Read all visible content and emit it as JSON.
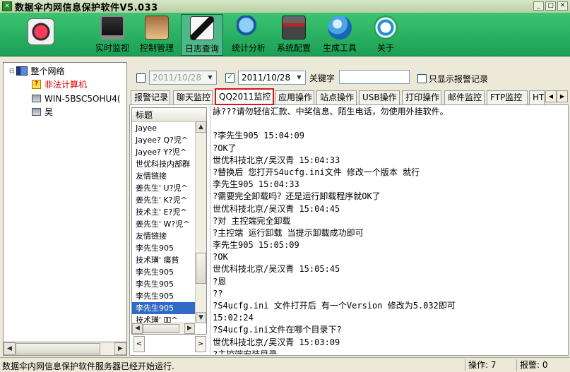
{
  "window": {
    "title": "数据伞内网信息保护软件V5.033"
  },
  "toolbar": {
    "items": [
      {
        "label": "",
        "icon": "record-icon"
      },
      {
        "label": "实时监视",
        "icon": "monitor-icon"
      },
      {
        "label": "控制管理",
        "icon": "people-icon"
      },
      {
        "label": "日志查询",
        "icon": "log-icon",
        "active": true
      },
      {
        "label": "统计分析",
        "icon": "magnifier-icon"
      },
      {
        "label": "系统配置",
        "icon": "tools-icon"
      },
      {
        "label": "生成工具",
        "icon": "globe-icon"
      },
      {
        "label": "关于",
        "icon": "at-icon"
      }
    ]
  },
  "tree": {
    "root": "整个网络",
    "items": [
      "非法计算机",
      "WIN-5BSC5OHU4(",
      "吴"
    ]
  },
  "filter": {
    "date_from": "2011/10/28",
    "date_to": "2011/10/28",
    "keyword_label": "关键字",
    "keyword_value": "",
    "alarm_only_label": "只显示报警记录"
  },
  "tabs": [
    "报警记录",
    "聊天监控",
    "QQ2011监控",
    "应用操作",
    "站点操作",
    "USB操作",
    "打印操作",
    "邮件监控",
    "FTP监控",
    "HT"
  ],
  "active_tab": "QQ2011监控",
  "contact_list": {
    "header": "标题",
    "rows": [
      "Jayee",
      "Jayee?  Q?児^",
      "Jayee?  Y?児^",
      "世优科技内部群",
      "友情链接",
      "姜先生' U?児^",
      "姜先生' K?児^",
      "技术主' E?児^",
      "姜先生' W?児^",
      "友情链接",
      "李先生905",
      "技术璜'  瘍貧",
      "李先生905",
      "李先生905",
      "李先生905",
      "李先生905",
      "技术璜'  吅^"
    ],
    "selected_index": 15
  },
  "chat": {
    "lines": [
      "詠???请勿轻信汇款、中奖信息、陌生电话，勿使用外挂软件。",
      "",
      "?李先生905  15:04:09",
      "?OK了",
      "世优科技北京/吴汉青  15:04:33",
      "?替换后 您打开S4ucfg.ini文件 修改一个版本 就行",
      "李先生905  15:04:33",
      "?需要完全卸载吗？还是运行卸载程序就OK了",
      "世优科技北京/吴汉青  15:04:45",
      "?对 主控端完全卸载",
      "?主控端 运行卸载 当提示卸载成功即可",
      "李先生905  15:05:09",
      "?OK",
      "世优科技北京/吴汉青  15:05:45",
      "?恩",
      "??",
      "?S4ucfg.ini 文件打开后 有一个Version 修改为5.032即可",
      "15:02:24",
      "?S4ucfg.ini文件在哪个目录下?",
      "世优科技北京/吴汉青  15:03:09",
      "?主控端安装目录"
    ]
  },
  "status": {
    "message": "数据伞内网信息保护软件服务器已经开始运行.",
    "ops": "操作: 7",
    "alarms": "报警: 0"
  }
}
